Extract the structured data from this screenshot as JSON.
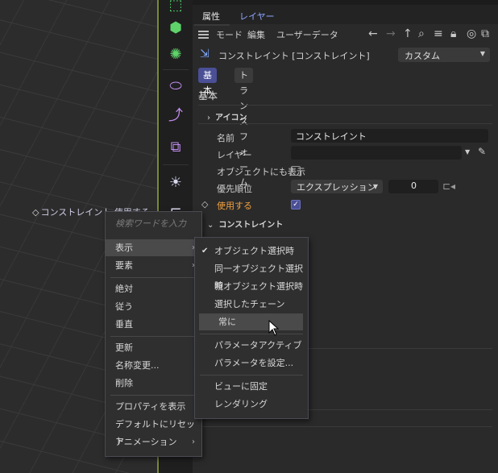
{
  "viewport": {
    "label": "コンストレイント.使用する"
  },
  "tabs": {
    "attributes": "属性",
    "layers": "レイヤー"
  },
  "menubar": {
    "mode": "モード",
    "edit": "編集",
    "userdata": "ユーザーデータ"
  },
  "object": {
    "title": "コンストレイント [コンストレイント]",
    "preset": "カスタム"
  },
  "buttons": {
    "basic": "基本",
    "transform": "トランスフォーム"
  },
  "section": {
    "title": "基本"
  },
  "groups": {
    "icon": "アイコン",
    "constraint": "コンストレイント"
  },
  "props": {
    "name_label": "名前",
    "name_value": "コンストレイント",
    "layer_label": "レイヤー",
    "show_in_object_label": "オブジェクトにも表示",
    "priority_label": "優先順位",
    "priority_mode": "エクスプレッション",
    "priority_value": "0",
    "use_label": "使用する"
  },
  "context_menu": {
    "search_placeholder": "検索ワードを入力",
    "items": [
      "表示",
      "要素",
      "絶対",
      "従う",
      "垂直",
      "更新",
      "名称変更...",
      "削除",
      "プロパティを表示",
      "デフォルトにリセット",
      "アニメーション"
    ]
  },
  "submenu": {
    "items": [
      "オブジェクト選択時",
      "同一オブジェクト選択時",
      "親オブジェクト選択時",
      "選択したチェーン",
      "常に",
      "パラメータアクティブ",
      "パラメータを設定...",
      "ビューに固定",
      "レンダリング"
    ]
  },
  "colors": {
    "accent": "#4a4f96",
    "orange": "#f0a040",
    "link": "#8ea6ff"
  }
}
